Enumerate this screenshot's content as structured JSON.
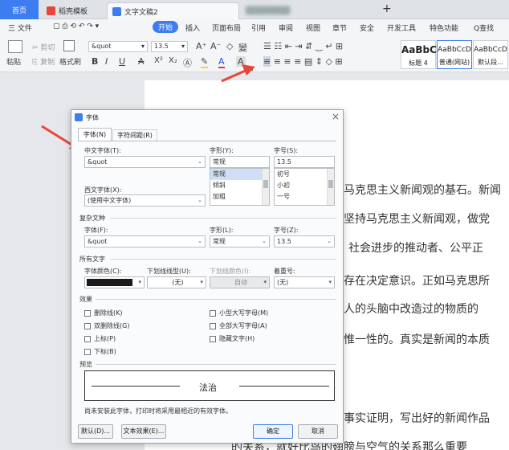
{
  "tabs": {
    "home": "首页",
    "template": "稻壳模板",
    "doc": "文字文稿2",
    "blurred": "████████"
  },
  "menu": {
    "file": "三 文件",
    "start": "开始",
    "insert": "插入",
    "layout": "页面布局",
    "references": "引用",
    "review": "审阅",
    "view": "视图",
    "chapter": "章节",
    "security": "安全",
    "devtools": "开发工具",
    "special": "特色功能",
    "search": "Q查找"
  },
  "toolbar": {
    "cut": "剪切",
    "paste": "粘贴",
    "copy": "复制",
    "format_painter": "格式刷",
    "font_name": "&quot",
    "font_size": "13.5",
    "bold": "B",
    "italic": "I",
    "underline": "U",
    "strike": "A",
    "superscript": "X²",
    "subscript": "X₂",
    "font_color": "A",
    "clear": "A",
    "grow": "A⁺",
    "shrink": "A⁻",
    "styles": [
      {
        "preview": "AaBbC",
        "name": "标题 4"
      },
      {
        "preview": "AaBbCcD",
        "name": "普通(网站)"
      },
      {
        "preview": "AaBbCcD",
        "name": "默认段..."
      }
    ]
  },
  "document": {
    "lines": [
      "马克思主义新闻观的基石。新闻",
      "坚持马克思主义新闻观，做党",
      "社会进步的推动者、公平正",
      "存在决定意识。正如马克思所",
      "人的头脑中改造过的物质的",
      "惟一性的。真实是新闻的本质",
      "事实证明，写出好的新闻作品",
      "的关系，就好比鸟的翅膀与空气的关系那么重要"
    ]
  },
  "dialog": {
    "title": "字体",
    "tabs": [
      "字体(N)",
      "字符间距(R)"
    ],
    "chinese_font_label": "中文字体(T):",
    "chinese_font_value": "&quot",
    "style_label": "字形(Y):",
    "style_value": "常规",
    "style_options": [
      "常规",
      "倾斜",
      "加粗"
    ],
    "size_label": "字号(S):",
    "size_value": "13.5",
    "size_options": [
      "初号",
      "小初",
      "一号"
    ],
    "western_font_label": "西文字体(X):",
    "western_font_value": "(使用中文字体)",
    "complex_section": "复杂文种",
    "complex_font_label": "字体(F):",
    "complex_font_value": "&quot",
    "complex_style_label": "字形(L):",
    "complex_style_value": "常规",
    "complex_size_label": "字号(Z):",
    "complex_size_value": "13.5",
    "all_text_section": "所有文字",
    "font_color_label": "字体颜色(C):",
    "underline_label": "下划线线型(U):",
    "underline_value": "(无)",
    "underline_color_label": "下划线颜色(I):",
    "underline_color_value": "自动",
    "emphasis_label": "着重号:",
    "emphasis_value": "(无)",
    "effects_section": "效果",
    "effects_left": [
      "删除线(K)",
      "双删除线(G)",
      "上标(P)",
      "下标(B)"
    ],
    "effects_right": [
      "小型大写字母(M)",
      "全部大写字母(A)",
      "隐藏文字(H)"
    ],
    "preview_section": "预览",
    "preview_text": "法治",
    "note": "尚未安装此字体，打印时将采用最相近的有效字体。",
    "default_button": "默认(D)...",
    "effects_button": "文本效果(E)...",
    "ok_button": "确定",
    "cancel_button": "取消"
  },
  "colors": {
    "accent": "#3c7df0",
    "arrow": "#e8453c",
    "font_color_swatch": "#1a1a1a"
  }
}
